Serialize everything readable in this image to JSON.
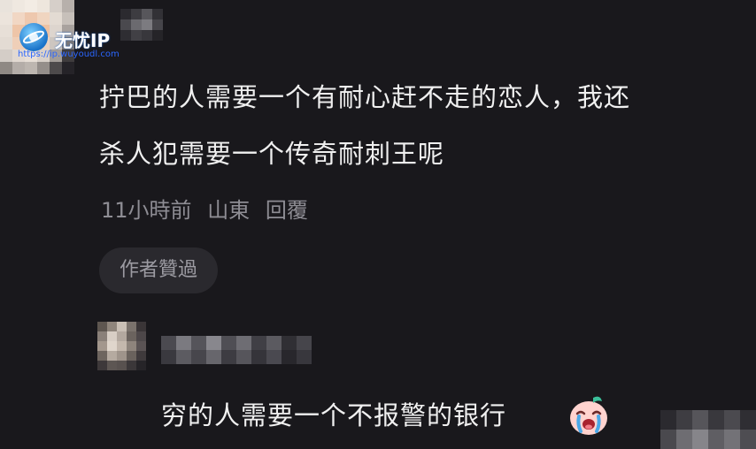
{
  "watermark": {
    "title": "无忧IP",
    "url": "https://ip.wuyoudl.com"
  },
  "comment": {
    "text_line1": "拧巴的人需要一个有耐心赶不走的恋人，我还",
    "text_line2": "杀人犯需要一个传奇耐刺王呢",
    "time": "11小時前",
    "location": "山東",
    "reply_label": "回覆",
    "author_liked_label": "作者贊過"
  },
  "reply": {
    "text": "穷的人需要一个不报警的银行",
    "emoji_icon": "crying-face-emoji-icon"
  },
  "colors": {
    "background": "#19181c",
    "text_primary": "#f0f0f0",
    "text_secondary": "#8e8d94",
    "chip_bg": "#2a292e",
    "watermark_blue": "#2a66ff"
  }
}
